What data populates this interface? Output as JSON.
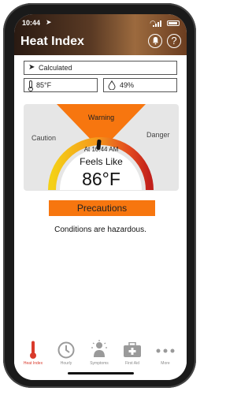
{
  "status_bar": {
    "time": "10:44"
  },
  "header": {
    "title": "Heat Index"
  },
  "location": {
    "label": "Calculated"
  },
  "readings": {
    "temperature": "85°F",
    "humidity": "49%"
  },
  "gauge": {
    "warning_label": "Warning",
    "caution_label": "Caution",
    "danger_label": "Danger",
    "time_text": "At 10:44 AM",
    "feels_like_label": "Feels Like",
    "value": "86°F"
  },
  "precautions_label": "Precautions",
  "conditions_text": "Conditions are hazardous.",
  "tabs": [
    {
      "label": "Heat Index",
      "active": true
    },
    {
      "label": "Hourly",
      "active": false
    },
    {
      "label": "Symptoms",
      "active": false
    },
    {
      "label": "First Aid",
      "active": false
    },
    {
      "label": "More",
      "active": false
    }
  ],
  "colors": {
    "accent_orange": "#f7760f",
    "active_tab": "#d93a2b"
  }
}
